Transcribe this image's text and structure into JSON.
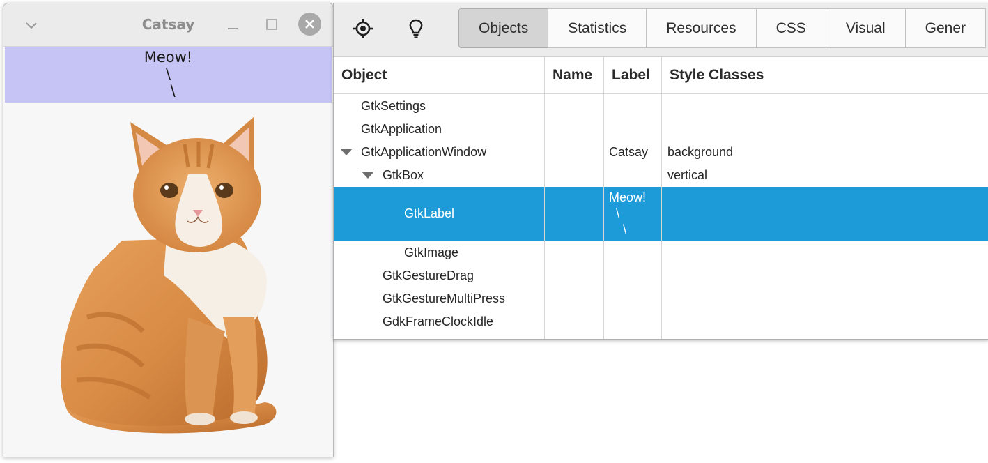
{
  "catsay_window": {
    "title": "Catsay",
    "speech_text": "Meow!\n\\\n  \\",
    "speech_bg": "#c6c4f5",
    "image": "orange-kitten"
  },
  "inspector": {
    "toolbar": {
      "icons": [
        "target-icon",
        "lightbulb-icon"
      ],
      "tabs": [
        {
          "label": "Objects",
          "active": true
        },
        {
          "label": "Statistics",
          "active": false
        },
        {
          "label": "Resources",
          "active": false
        },
        {
          "label": "CSS",
          "active": false
        },
        {
          "label": "Visual",
          "active": false
        },
        {
          "label": "Gener",
          "active": false
        }
      ]
    },
    "columns": [
      "Object",
      "Name",
      "Label",
      "Style Classes"
    ],
    "rows": [
      {
        "object": "GtkSettings",
        "name": "",
        "label": "",
        "style": ""
      },
      {
        "object": "GtkApplication",
        "name": "",
        "label": "",
        "style": ""
      },
      {
        "object": "GtkApplicationWindow",
        "name": "",
        "label": "Catsay",
        "style": "background"
      },
      {
        "object": "GtkBox",
        "name": "",
        "label": "",
        "style": "vertical"
      },
      {
        "object": "GtkLabel",
        "name": "",
        "label": "Meow!\n  \\\n    \\",
        "style": "",
        "selected": true
      },
      {
        "object": "GtkImage",
        "name": "",
        "label": "",
        "style": ""
      },
      {
        "object": "GtkGestureDrag",
        "name": "",
        "label": "",
        "style": ""
      },
      {
        "object": "GtkGestureMultiPress",
        "name": "",
        "label": "",
        "style": ""
      },
      {
        "object": "GdkFrameClockIdle",
        "name": "",
        "label": "",
        "style": ""
      }
    ],
    "selection_color": "#1d9bd9"
  }
}
